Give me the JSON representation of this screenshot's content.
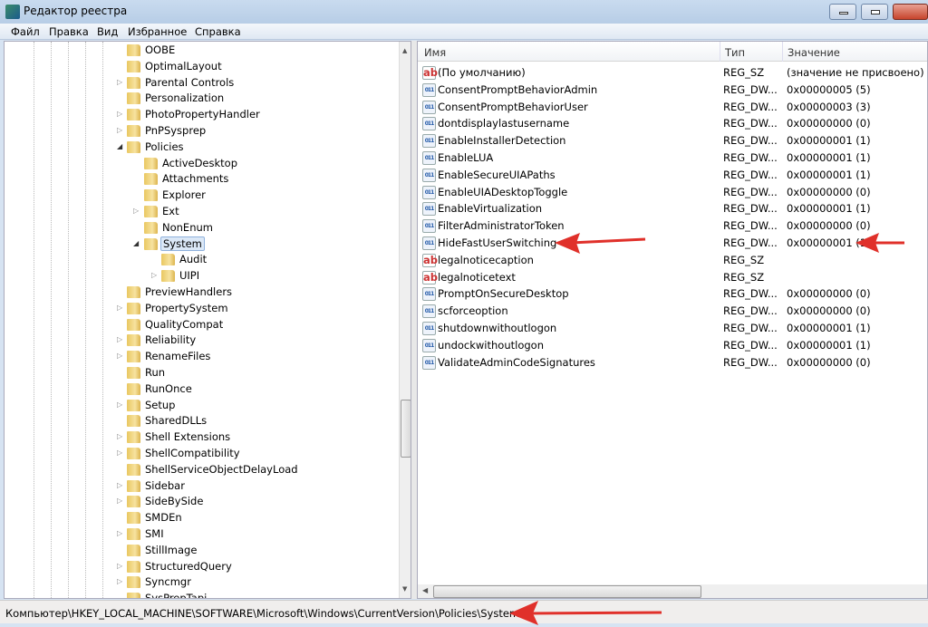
{
  "window": {
    "title": "Редактор реестра"
  },
  "menu": [
    "Файл",
    "Правка",
    "Вид",
    "Избранное",
    "Справка"
  ],
  "tree": [
    {
      "label": "OOBE",
      "level": 1,
      "exp": ""
    },
    {
      "label": "OptimalLayout",
      "level": 1,
      "exp": ""
    },
    {
      "label": "Parental Controls",
      "level": 1,
      "exp": "collapsed"
    },
    {
      "label": "Personalization",
      "level": 1,
      "exp": ""
    },
    {
      "label": "PhotoPropertyHandler",
      "level": 1,
      "exp": "collapsed"
    },
    {
      "label": "PnPSysprep",
      "level": 1,
      "exp": "collapsed"
    },
    {
      "label": "Policies",
      "level": 1,
      "exp": "expanded"
    },
    {
      "label": "ActiveDesktop",
      "level": 2,
      "exp": ""
    },
    {
      "label": "Attachments",
      "level": 2,
      "exp": ""
    },
    {
      "label": "Explorer",
      "level": 2,
      "exp": ""
    },
    {
      "label": "Ext",
      "level": 2,
      "exp": "collapsed"
    },
    {
      "label": "NonEnum",
      "level": 2,
      "exp": ""
    },
    {
      "label": "System",
      "level": 2,
      "exp": "expanded",
      "selected": true
    },
    {
      "label": "Audit",
      "level": 3,
      "exp": ""
    },
    {
      "label": "UIPI",
      "level": 3,
      "exp": "collapsed"
    },
    {
      "label": "PreviewHandlers",
      "level": 1,
      "exp": ""
    },
    {
      "label": "PropertySystem",
      "level": 1,
      "exp": "collapsed"
    },
    {
      "label": "QualityCompat",
      "level": 1,
      "exp": ""
    },
    {
      "label": "Reliability",
      "level": 1,
      "exp": "collapsed"
    },
    {
      "label": "RenameFiles",
      "level": 1,
      "exp": "collapsed"
    },
    {
      "label": "Run",
      "level": 1,
      "exp": ""
    },
    {
      "label": "RunOnce",
      "level": 1,
      "exp": ""
    },
    {
      "label": "Setup",
      "level": 1,
      "exp": "collapsed"
    },
    {
      "label": "SharedDLLs",
      "level": 1,
      "exp": ""
    },
    {
      "label": "Shell Extensions",
      "level": 1,
      "exp": "collapsed"
    },
    {
      "label": "ShellCompatibility",
      "level": 1,
      "exp": "collapsed"
    },
    {
      "label": "ShellServiceObjectDelayLoad",
      "level": 1,
      "exp": ""
    },
    {
      "label": "Sidebar",
      "level": 1,
      "exp": "collapsed"
    },
    {
      "label": "SideBySide",
      "level": 1,
      "exp": "collapsed"
    },
    {
      "label": "SMDEn",
      "level": 1,
      "exp": ""
    },
    {
      "label": "SMI",
      "level": 1,
      "exp": "collapsed"
    },
    {
      "label": "StillImage",
      "level": 1,
      "exp": ""
    },
    {
      "label": "StructuredQuery",
      "level": 1,
      "exp": "collapsed"
    },
    {
      "label": "Syncmgr",
      "level": 1,
      "exp": "collapsed"
    },
    {
      "label": "SysPrepTapi",
      "level": 1,
      "exp": ""
    }
  ],
  "list": {
    "columns": [
      "Имя",
      "Тип",
      "Значение"
    ],
    "rows": [
      {
        "icon": "string-value-icon",
        "name": "(По умолчанию)",
        "type": "REG_SZ",
        "value": "(значение не присвоено)"
      },
      {
        "icon": "dword-value-icon",
        "name": "ConsentPromptBehaviorAdmin",
        "type": "REG_DW...",
        "value": "0x00000005 (5)"
      },
      {
        "icon": "dword-value-icon",
        "name": "ConsentPromptBehaviorUser",
        "type": "REG_DW...",
        "value": "0x00000003 (3)"
      },
      {
        "icon": "dword-value-icon",
        "name": "dontdisplaylastusername",
        "type": "REG_DW...",
        "value": "0x00000000 (0)"
      },
      {
        "icon": "dword-value-icon",
        "name": "EnableInstallerDetection",
        "type": "REG_DW...",
        "value": "0x00000001 (1)"
      },
      {
        "icon": "dword-value-icon",
        "name": "EnableLUA",
        "type": "REG_DW...",
        "value": "0x00000001 (1)"
      },
      {
        "icon": "dword-value-icon",
        "name": "EnableSecureUIAPaths",
        "type": "REG_DW...",
        "value": "0x00000001 (1)"
      },
      {
        "icon": "dword-value-icon",
        "name": "EnableUIADesktopToggle",
        "type": "REG_DW...",
        "value": "0x00000000 (0)"
      },
      {
        "icon": "dword-value-icon",
        "name": "EnableVirtualization",
        "type": "REG_DW...",
        "value": "0x00000001 (1)"
      },
      {
        "icon": "dword-value-icon",
        "name": "FilterAdministratorToken",
        "type": "REG_DW...",
        "value": "0x00000000 (0)"
      },
      {
        "icon": "dword-value-icon",
        "name": "HideFastUserSwitching",
        "type": "REG_DW...",
        "value": "0x00000001 (1)"
      },
      {
        "icon": "string-value-icon",
        "name": "legalnoticecaption",
        "type": "REG_SZ",
        "value": ""
      },
      {
        "icon": "string-value-icon",
        "name": "legalnoticetext",
        "type": "REG_SZ",
        "value": ""
      },
      {
        "icon": "dword-value-icon",
        "name": "PromptOnSecureDesktop",
        "type": "REG_DW...",
        "value": "0x00000000 (0)"
      },
      {
        "icon": "dword-value-icon",
        "name": "scforceoption",
        "type": "REG_DW...",
        "value": "0x00000000 (0)"
      },
      {
        "icon": "dword-value-icon",
        "name": "shutdownwithoutlogon",
        "type": "REG_DW...",
        "value": "0x00000001 (1)"
      },
      {
        "icon": "dword-value-icon",
        "name": "undockwithoutlogon",
        "type": "REG_DW...",
        "value": "0x00000001 (1)"
      },
      {
        "icon": "dword-value-icon",
        "name": "ValidateAdminCodeSignatures",
        "type": "REG_DW...",
        "value": "0x00000000 (0)"
      }
    ]
  },
  "status": {
    "path": "Компьютер\\HKEY_LOCAL_MACHINE\\SOFTWARE\\Microsoft\\Windows\\CurrentVersion\\Policies\\System"
  },
  "colors": {
    "annotation_arrow": "#e0302a",
    "selection": "#dbe8f7"
  }
}
